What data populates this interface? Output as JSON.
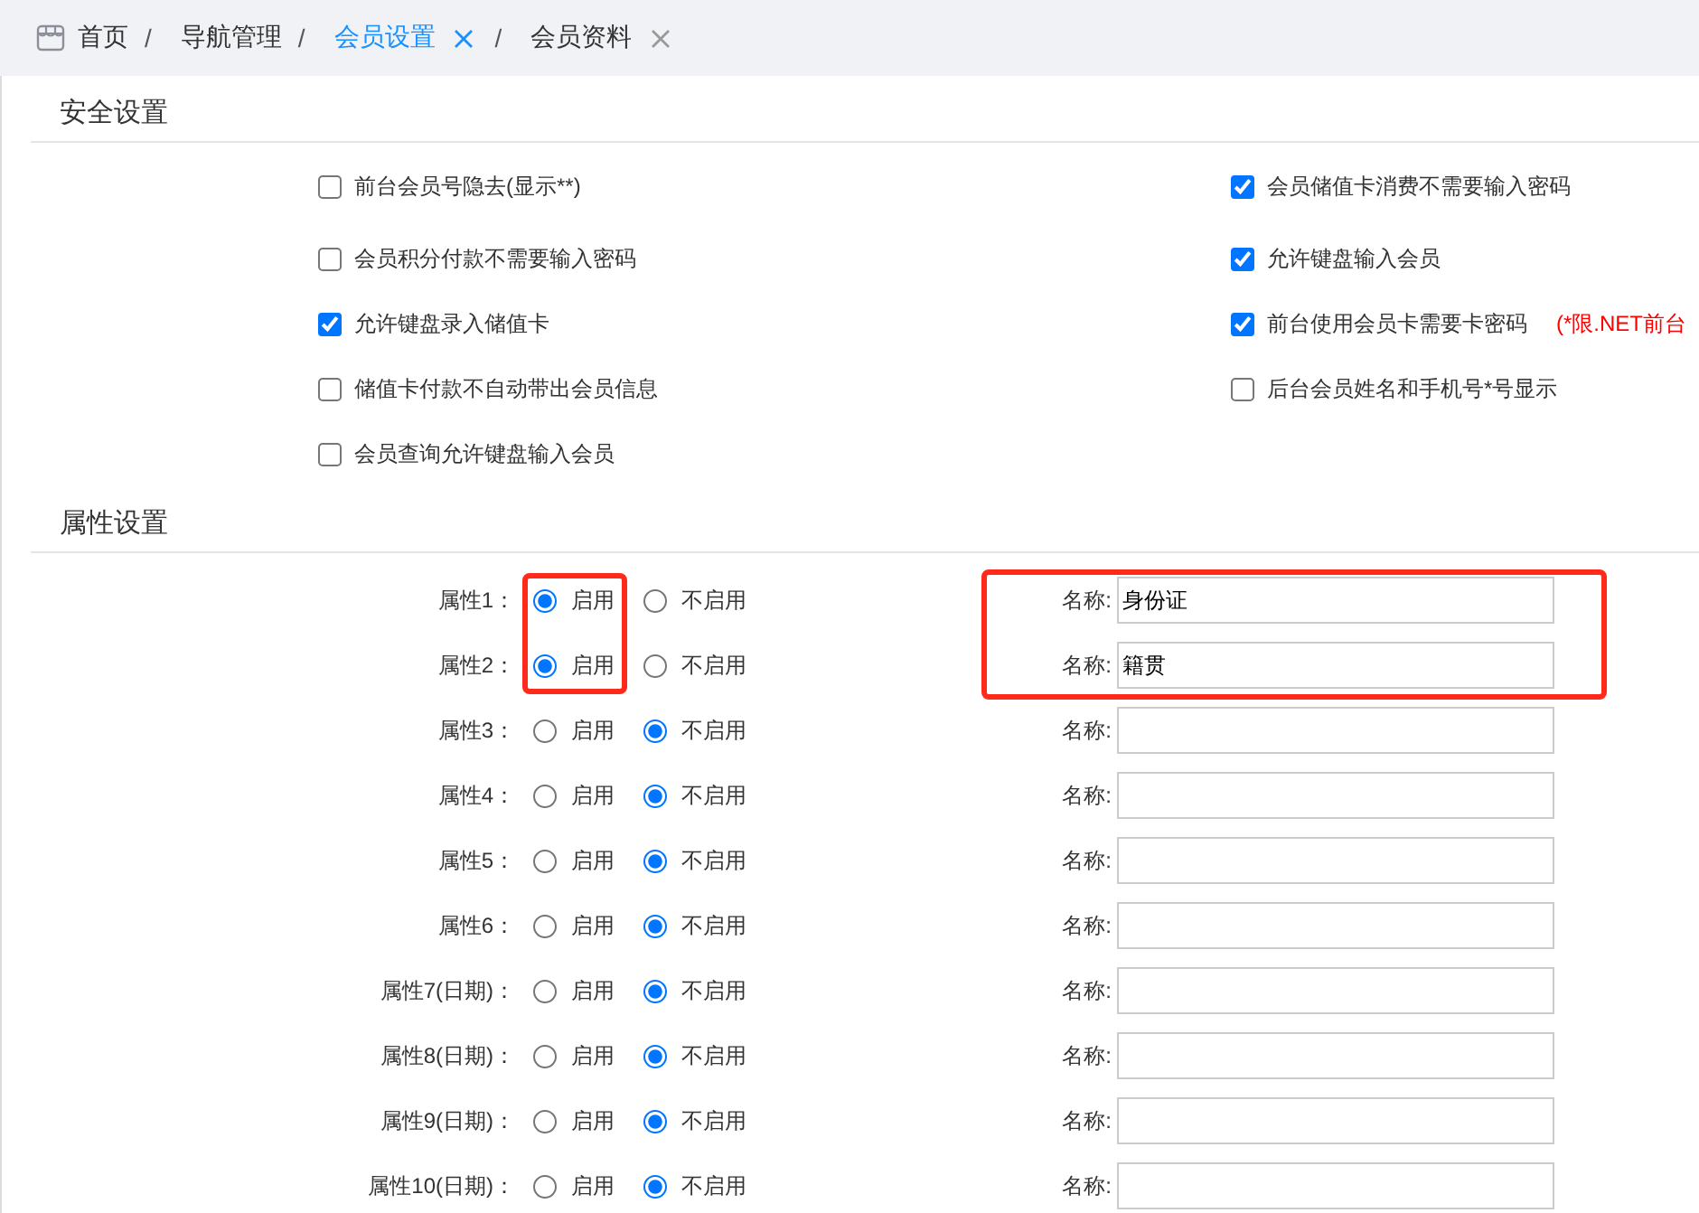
{
  "breadcrumb": {
    "separator": "/",
    "items": [
      {
        "label": "首页",
        "kind": "home"
      },
      {
        "label": "导航管理",
        "kind": "link"
      },
      {
        "label": "会员设置",
        "kind": "tab",
        "selected": true
      },
      {
        "label": "会员资料",
        "kind": "tab",
        "selected": false
      }
    ]
  },
  "security": {
    "title": "安全设置",
    "columns": [
      {
        "options": [
          {
            "label": "前台会员号隐去(显示**)",
            "checked": false
          },
          {
            "label": "会员积分付款不需要输入密码",
            "checked": false
          },
          {
            "label": "允许键盘录入储值卡",
            "checked": true
          },
          {
            "label": "储值卡付款不自动带出会员信息",
            "checked": false
          },
          {
            "label": "会员查询允许键盘输入会员",
            "checked": false
          }
        ]
      },
      {
        "options": [
          {
            "label": "会员储值卡消费不需要输入密码",
            "checked": true
          },
          {
            "label": "允许键盘输入会员",
            "checked": true
          },
          {
            "label": "前台使用会员卡需要卡密码",
            "checked": true,
            "note": "(*限.NET前台"
          },
          {
            "label": "后台会员姓名和手机号*号显示",
            "checked": false
          }
        ]
      }
    ]
  },
  "attributes": {
    "title": "属性设置",
    "rows": [
      {
        "label": "属性1：",
        "options": [
          {
            "label": "启用",
            "selected": true
          },
          {
            "label": "不启用",
            "selected": false
          }
        ],
        "name_label": "名称:",
        "value": "身份证",
        "highlighted": true
      },
      {
        "label": "属性2：",
        "options": [
          {
            "label": "启用",
            "selected": true
          },
          {
            "label": "不启用",
            "selected": false
          }
        ],
        "name_label": "名称:",
        "value": "籍贯",
        "highlighted": true
      },
      {
        "label": "属性3：",
        "options": [
          {
            "label": "启用",
            "selected": false
          },
          {
            "label": "不启用",
            "selected": true
          }
        ],
        "name_label": "名称:",
        "highlighted": false
      },
      {
        "label": "属性4：",
        "options": [
          {
            "label": "启用",
            "selected": false
          },
          {
            "label": "不启用",
            "selected": true
          }
        ],
        "name_label": "名称:",
        "highlighted": false
      },
      {
        "label": "属性5：",
        "options": [
          {
            "label": "启用",
            "selected": false
          },
          {
            "label": "不启用",
            "selected": true
          }
        ],
        "name_label": "名称:",
        "highlighted": false
      },
      {
        "label": "属性6：",
        "options": [
          {
            "label": "启用",
            "selected": false
          },
          {
            "label": "不启用",
            "selected": true
          }
        ],
        "name_label": "名称:",
        "highlighted": false
      },
      {
        "label": "属性7(日期)：",
        "options": [
          {
            "label": "启用",
            "selected": false
          },
          {
            "label": "不启用",
            "selected": true
          }
        ],
        "name_label": "名称:",
        "highlighted": false
      },
      {
        "label": "属性8(日期)：",
        "options": [
          {
            "label": "启用",
            "selected": false
          },
          {
            "label": "不启用",
            "selected": true
          }
        ],
        "name_label": "名称:",
        "highlighted": false
      },
      {
        "label": "属性9(日期)：",
        "options": [
          {
            "label": "启用",
            "selected": false
          },
          {
            "label": "不启用",
            "selected": true
          }
        ],
        "name_label": "名称:",
        "highlighted": false
      },
      {
        "label": "属性10(日期)：",
        "options": [
          {
            "label": "启用",
            "selected": false
          },
          {
            "label": "不启用",
            "selected": true
          }
        ],
        "name_label": "名称:",
        "highlighted": false
      }
    ]
  }
}
